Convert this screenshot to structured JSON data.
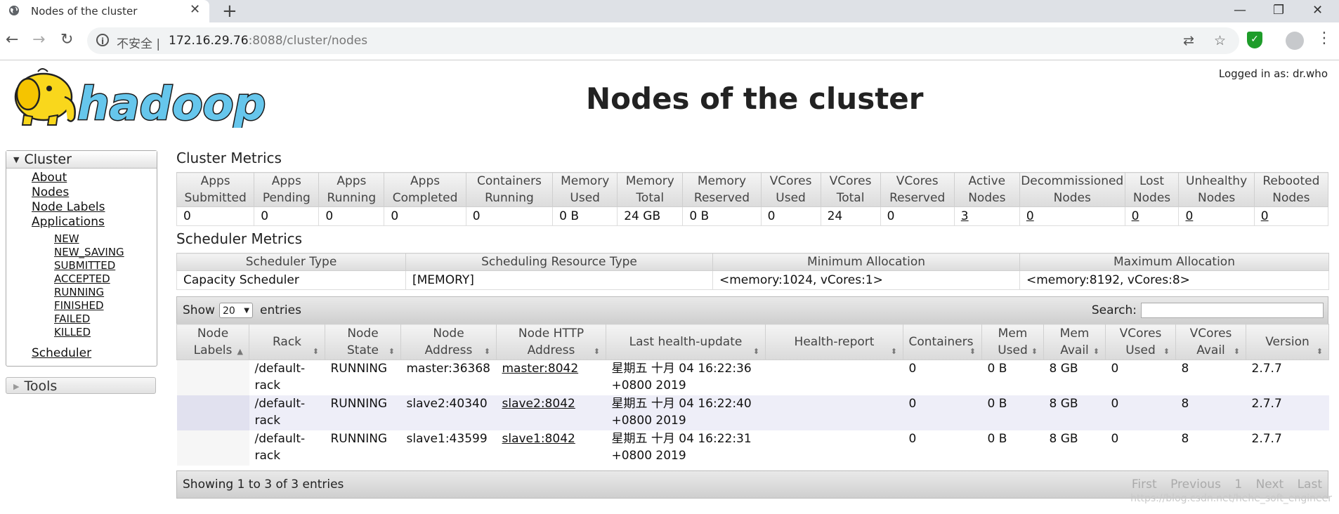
{
  "browser": {
    "tab_title": "Nodes of the cluster",
    "insecure_label": "不安全",
    "url_host": "172.16.29.76",
    "url_rest": ":8088/cluster/nodes"
  },
  "header": {
    "logged_in": "Logged in as: dr.who",
    "title": "Nodes of the cluster",
    "logo_text": "hadoop"
  },
  "sidebar": {
    "cluster_label": "Cluster",
    "links": [
      "About",
      "Nodes",
      "Node Labels",
      "Applications"
    ],
    "app_states": [
      "NEW",
      "NEW_SAVING",
      "SUBMITTED",
      "ACCEPTED",
      "RUNNING",
      "FINISHED",
      "FAILED",
      "KILLED"
    ],
    "scheduler_label": "Scheduler",
    "tools_label": "Tools"
  },
  "cluster_metrics": {
    "title": "Cluster Metrics",
    "headers": [
      [
        "Apps",
        "Submitted"
      ],
      [
        "Apps",
        "Pending"
      ],
      [
        "Apps",
        "Running"
      ],
      [
        "Apps",
        "Completed"
      ],
      [
        "Containers",
        "Running"
      ],
      [
        "Memory",
        "Used"
      ],
      [
        "Memory",
        "Total"
      ],
      [
        "Memory",
        "Reserved"
      ],
      [
        "VCores",
        "Used"
      ],
      [
        "VCores",
        "Total"
      ],
      [
        "VCores",
        "Reserved"
      ],
      [
        "Active",
        "Nodes"
      ],
      [
        "Decommissioned",
        "Nodes"
      ],
      [
        "Lost",
        "Nodes"
      ],
      [
        "Unhealthy",
        "Nodes"
      ],
      [
        "Rebooted",
        "Nodes"
      ]
    ],
    "values": [
      "0",
      "0",
      "0",
      "0",
      "0",
      "0 B",
      "24 GB",
      "0 B",
      "0",
      "24",
      "0",
      "3",
      "0",
      "0",
      "0",
      "0"
    ]
  },
  "scheduler_metrics": {
    "title": "Scheduler Metrics",
    "headers": [
      "Scheduler Type",
      "Scheduling Resource Type",
      "Minimum Allocation",
      "Maximum Allocation"
    ],
    "values": [
      "Capacity Scheduler",
      "[MEMORY]",
      "<memory:1024, vCores:1>",
      "<memory:8192, vCores:8>"
    ]
  },
  "nodes_table": {
    "show_label": "Show",
    "page_length": "20",
    "entries_label": "entries",
    "search_label": "Search:",
    "headers": [
      "Node Labels",
      "Rack",
      "Node State",
      "Node Address",
      "Node HTTP Address",
      "Last health-update",
      "Health-report",
      "Containers",
      "Mem Used",
      "Mem Avail",
      "VCores Used",
      "VCores Avail",
      "Version"
    ],
    "rows": [
      {
        "labels": "",
        "rack": "/default-rack",
        "state": "RUNNING",
        "address": "master:36368",
        "http": "master:8042",
        "health_update": "星期五 十月 04 16:22:36 +0800 2019",
        "report": "",
        "containers": "0",
        "mem_used": "0 B",
        "mem_avail": "8 GB",
        "vcores_used": "0",
        "vcores_avail": "8",
        "version": "2.7.7"
      },
      {
        "labels": "",
        "rack": "/default-rack",
        "state": "RUNNING",
        "address": "slave2:40340",
        "http": "slave2:8042",
        "health_update": "星期五 十月 04 16:22:40 +0800 2019",
        "report": "",
        "containers": "0",
        "mem_used": "0 B",
        "mem_avail": "8 GB",
        "vcores_used": "0",
        "vcores_avail": "8",
        "version": "2.7.7"
      },
      {
        "labels": "",
        "rack": "/default-rack",
        "state": "RUNNING",
        "address": "slave1:43599",
        "http": "slave1:8042",
        "health_update": "星期五 十月 04 16:22:31 +0800 2019",
        "report": "",
        "containers": "0",
        "mem_used": "0 B",
        "mem_avail": "8 GB",
        "vcores_used": "0",
        "vcores_avail": "8",
        "version": "2.7.7"
      }
    ],
    "showing": "Showing 1 to 3 of 3 entries",
    "pager": [
      "First",
      "Previous",
      "1",
      "Next",
      "Last"
    ]
  },
  "watermark": "https://blog.csdn.net/hehe_soft_engineer"
}
